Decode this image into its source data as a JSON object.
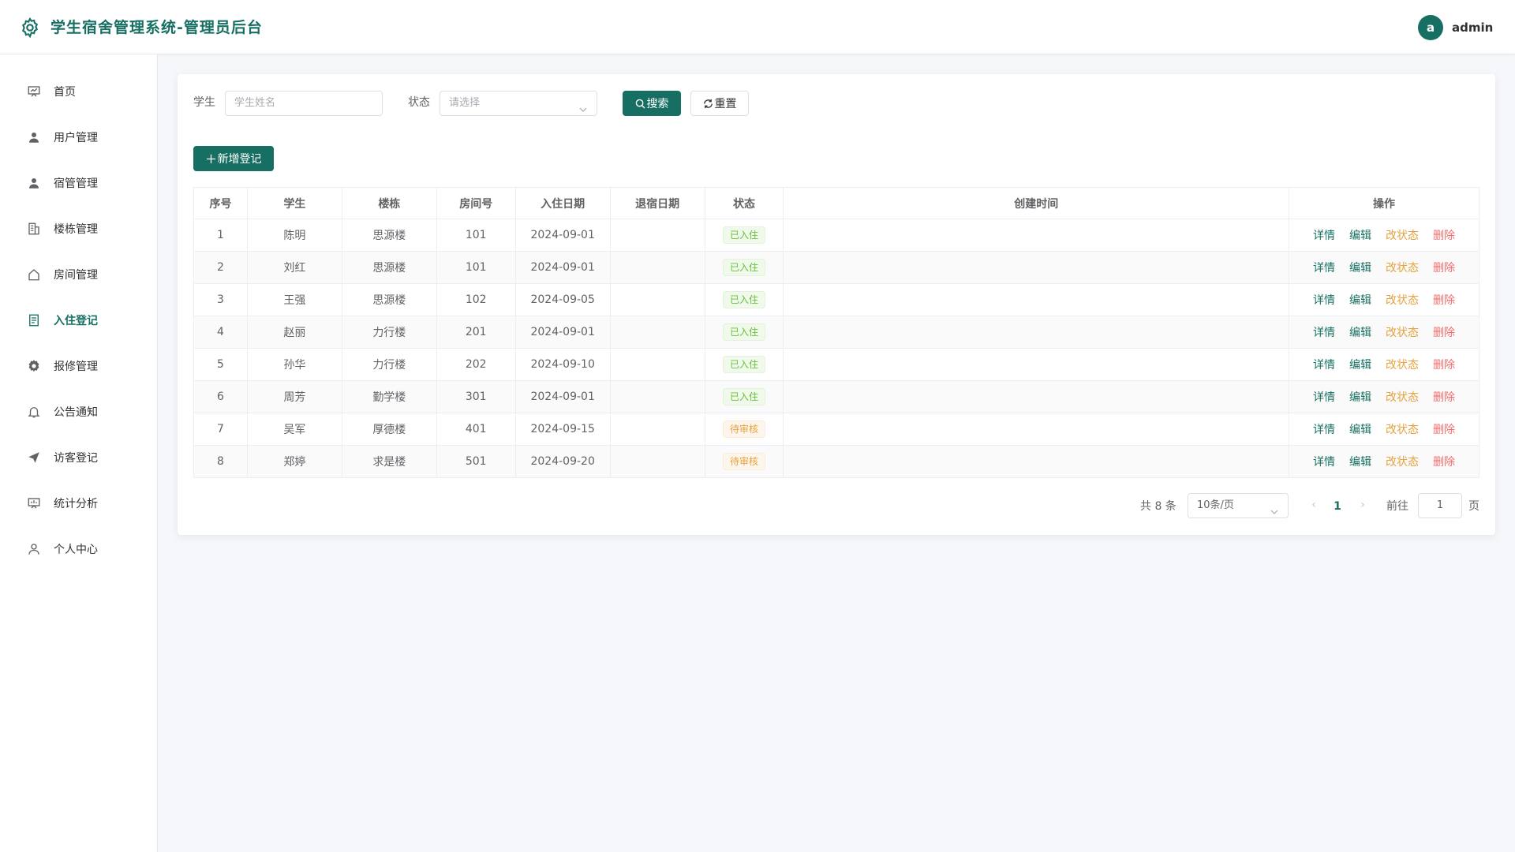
{
  "header": {
    "title": "学生宿舍管理系统-管理员后台",
    "avatar_letter": "a",
    "username": "admin",
    "brand_color": "#176f63"
  },
  "sidebar": {
    "items": [
      {
        "label": "首页",
        "icon": "dashboard-icon"
      },
      {
        "label": "用户管理",
        "icon": "user-icon"
      },
      {
        "label": "宿管管理",
        "icon": "user-icon"
      },
      {
        "label": "楼栋管理",
        "icon": "building-icon"
      },
      {
        "label": "房间管理",
        "icon": "house-icon"
      },
      {
        "label": "入住登记",
        "icon": "document-icon",
        "active": true
      },
      {
        "label": "报修管理",
        "icon": "gear-icon"
      },
      {
        "label": "公告通知",
        "icon": "bell-icon"
      },
      {
        "label": "访客登记",
        "icon": "send-icon"
      },
      {
        "label": "统计分析",
        "icon": "chart-board-icon"
      },
      {
        "label": "个人中心",
        "icon": "person-outline-icon"
      }
    ]
  },
  "filters": {
    "student_label": "学生",
    "student_placeholder": "学生姓名",
    "status_label": "状态",
    "status_placeholder": "请选择",
    "search_button": "搜索",
    "reset_button": "重置"
  },
  "actions": {
    "add_button": "新增登记"
  },
  "table": {
    "columns": [
      "序号",
      "学生",
      "楼栋",
      "房间号",
      "入住日期",
      "退宿日期",
      "状态",
      "创建时间",
      "操作"
    ],
    "op_labels": {
      "detail": "详情",
      "edit": "编辑",
      "status": "改状态",
      "delete": "删除"
    },
    "rows": [
      {
        "no": "1",
        "student": "陈明",
        "building": "思源楼",
        "room": "101",
        "checkin": "2024-09-01",
        "checkout": "",
        "status": "已入住",
        "status_type": "success",
        "created": ""
      },
      {
        "no": "2",
        "student": "刘红",
        "building": "思源楼",
        "room": "101",
        "checkin": "2024-09-01",
        "checkout": "",
        "status": "已入住",
        "status_type": "success",
        "created": ""
      },
      {
        "no": "3",
        "student": "王强",
        "building": "思源楼",
        "room": "102",
        "checkin": "2024-09-05",
        "checkout": "",
        "status": "已入住",
        "status_type": "success",
        "created": ""
      },
      {
        "no": "4",
        "student": "赵丽",
        "building": "力行楼",
        "room": "201",
        "checkin": "2024-09-01",
        "checkout": "",
        "status": "已入住",
        "status_type": "success",
        "created": ""
      },
      {
        "no": "5",
        "student": "孙华",
        "building": "力行楼",
        "room": "202",
        "checkin": "2024-09-10",
        "checkout": "",
        "status": "已入住",
        "status_type": "success",
        "created": ""
      },
      {
        "no": "6",
        "student": "周芳",
        "building": "勤学楼",
        "room": "301",
        "checkin": "2024-09-01",
        "checkout": "",
        "status": "已入住",
        "status_type": "success",
        "created": ""
      },
      {
        "no": "7",
        "student": "吴军",
        "building": "厚德楼",
        "room": "401",
        "checkin": "2024-09-15",
        "checkout": "",
        "status": "待审核",
        "status_type": "warning",
        "created": ""
      },
      {
        "no": "8",
        "student": "郑婷",
        "building": "求是楼",
        "room": "501",
        "checkin": "2024-09-20",
        "checkout": "",
        "status": "待审核",
        "status_type": "warning",
        "created": ""
      }
    ]
  },
  "pagination": {
    "total_text": "共 8 条",
    "page_size": "10条/页",
    "prev": "‹",
    "current_page": "1",
    "next": "›",
    "goto_label": "前往",
    "goto_value": "1",
    "page_suffix": "页"
  }
}
